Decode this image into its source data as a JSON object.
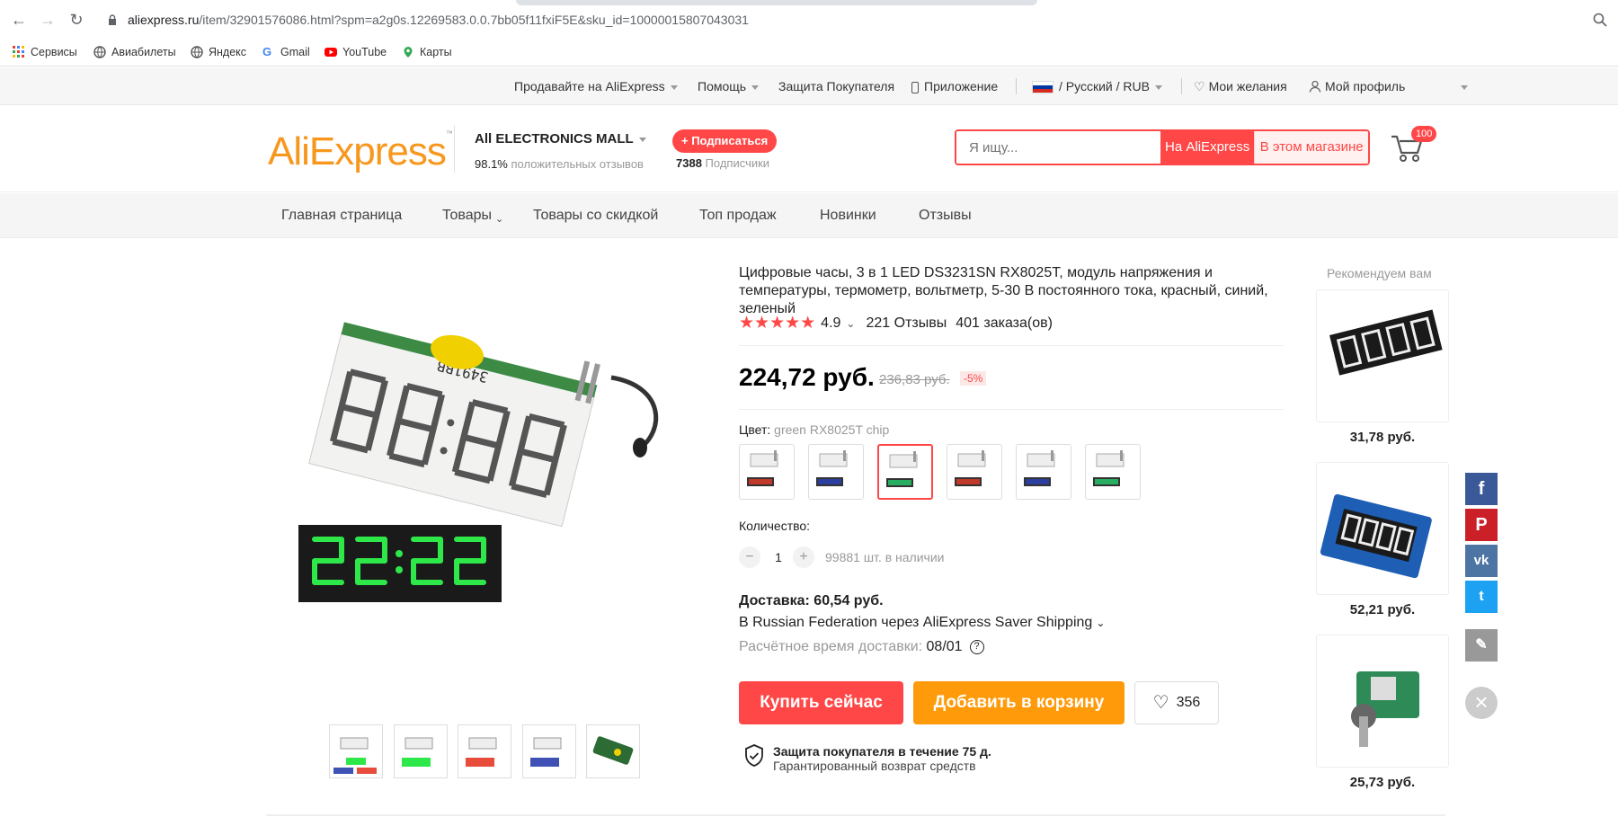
{
  "browser": {
    "url_host": "aliexpress.ru",
    "url_path": "/item/32901576086.html?spm=a2g0s.12269583.0.0.7bb05f11fxiF5E&sku_id=10000015807043031",
    "bookmarks": [
      "Сервисы",
      "Авиабилеты",
      "Яндекс",
      "Gmail",
      "YouTube",
      "Карты"
    ]
  },
  "topnav": {
    "sell": "Продавайте на AliExpress",
    "help": "Помощь",
    "protection": "Защита Покупателя",
    "app": "Приложение",
    "locale": "/ Русский /  RUB",
    "wishlist": "Мои желания",
    "profile": "Мой профиль"
  },
  "header": {
    "logo": "AliExpress",
    "store_name": "All ELECTRONICS MALL",
    "store_rating_value": "98.1%",
    "store_rating_text": "положительных отзывов",
    "subscribe": "+ Подписаться",
    "subscribers_count": "7388",
    "subscribers_text": "Подписчики",
    "search_placeholder": "Я ищу...",
    "search_all": "На AliExpress",
    "search_store": "В этом магазине",
    "cart_count": "100"
  },
  "storenav": [
    "Главная страница",
    "Товары",
    "Товары со скидкой",
    "Топ продаж",
    "Новинки",
    "Отзывы"
  ],
  "product": {
    "title": "Цифровые часы, 3 в 1 LED DS3231SN RX8025T, модуль напряжения и температуры, термометр, вольтметр, 5-30 В постоянного тока, красный, синий, зеленый",
    "rating": "4.9",
    "reviews": "221 Отзывы",
    "orders": "401 заказа(ов)",
    "price": "224,72 руб.",
    "old_price": "236,83 руб.",
    "discount": "-5%",
    "color_label": "Цвет:",
    "color_value": "green RX8025T chip",
    "qty_label": "Количество:",
    "qty": "1",
    "stock": "99881 шт. в наличии",
    "shipping_price": "Доставка: 60,54 руб.",
    "shipping_method": "В Russian Federation через AliExpress Saver Shipping",
    "delivery_label": "Расчётное время доставки:",
    "delivery_date": "08/01",
    "buy_now": "Купить сейчас",
    "add_to_cart": "Добавить в корзину",
    "wish_count": "356",
    "protection_title": "Защита покупателя в течение 75 д.",
    "protection_sub": "Гарантированный возврат средств",
    "image_display": "3491BB",
    "swatch_colors": [
      "#c0392b",
      "#2c3e9e",
      "#27ae60",
      "#c0392b",
      "#2c3e9e",
      "#27ae60"
    ]
  },
  "recommendations": {
    "title": "Рекомендуем вам",
    "prices": [
      "31,78 руб.",
      "52,21 руб.",
      "25,73 руб."
    ]
  },
  "colors": {
    "accent": "#ff4747",
    "orange": "#ff9a0b"
  }
}
